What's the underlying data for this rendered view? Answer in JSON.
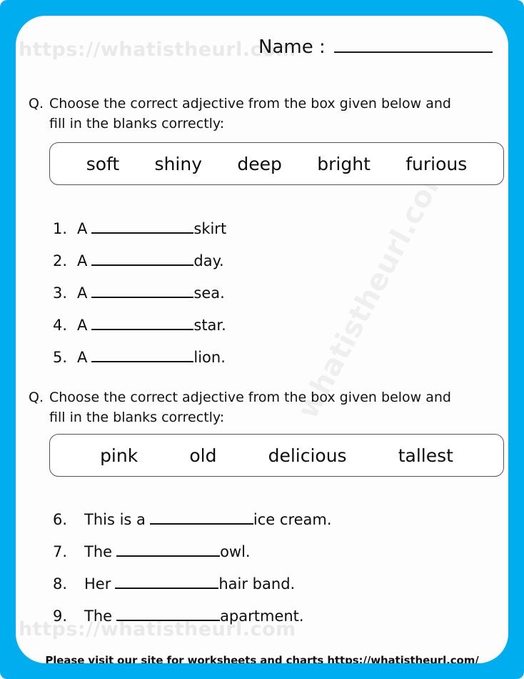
{
  "theme": {
    "border_color": "#00AEEF",
    "page_background": "#fdfdfd",
    "text_color": "#0d0d0d",
    "watermark_color": "#e9e9e9"
  },
  "header": {
    "name_label": "Name :",
    "name_value": ""
  },
  "watermarks": {
    "top": "https://whatistheurl.com",
    "bottom": "https://whatistheurl.com",
    "diagonal": "whatistheurl.com"
  },
  "sections": [
    {
      "marker": "Q.",
      "prompt": "Choose the correct adjective from the box given below and fill in the blanks correctly:",
      "word_bank": [
        "soft",
        "shiny",
        "deep",
        "bright",
        "furious"
      ],
      "items": [
        {
          "number": "1.",
          "pre": "A",
          "post": "skirt"
        },
        {
          "number": "2.",
          "pre": "A",
          "post": "day."
        },
        {
          "number": "3.",
          "pre": "A",
          "post": "sea."
        },
        {
          "number": "4.",
          "pre": "A",
          "post": "star."
        },
        {
          "number": "5.",
          "pre": "A",
          "post": "lion."
        }
      ]
    },
    {
      "marker": "Q.",
      "prompt": "Choose the correct adjective from the box given below and fill in the blanks correctly:",
      "word_bank": [
        "pink",
        "old",
        "delicious",
        "tallest"
      ],
      "items": [
        {
          "number": "6.",
          "pre": "This is a",
          "post": "ice cream."
        },
        {
          "number": "7.",
          "pre": "The",
          "post": "owl."
        },
        {
          "number": "8.",
          "pre": "Her",
          "post": "hair band."
        },
        {
          "number": "9.",
          "pre": "The",
          "post": "apartment."
        }
      ]
    }
  ],
  "footer": {
    "link_text": "Please visit our site for worksheets and charts https://whatistheurl.com/"
  }
}
